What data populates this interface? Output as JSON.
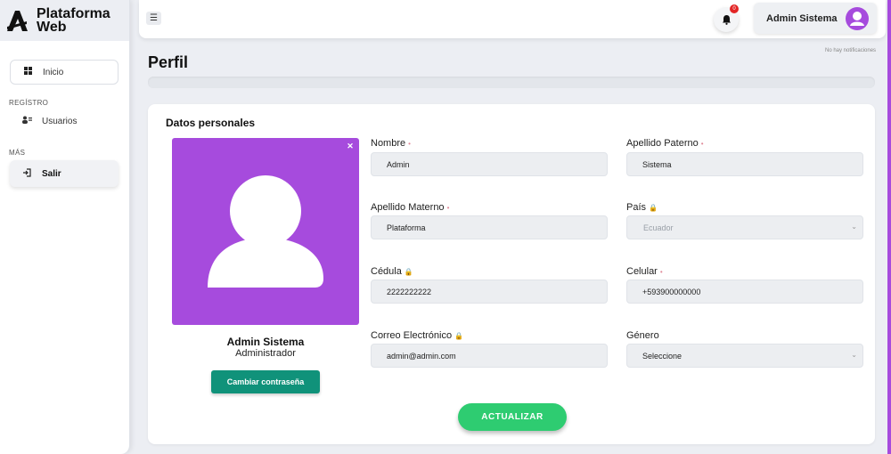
{
  "brand": {
    "name_line1": "Plataforma",
    "name_line2": "Web"
  },
  "sidebar": {
    "home_label": "Inicio",
    "section_registro": "REGÍSTRO",
    "users_label": "Usuarios",
    "section_mas": "MÁS",
    "logout_label": "Salir"
  },
  "topbar": {
    "notification_count": "0",
    "user_name": "Admin Sistema",
    "notification_text": "No hay notificaciones"
  },
  "page": {
    "title": "Perfil"
  },
  "profile": {
    "section_title": "Datos personales",
    "full_name": "Admin Sistema",
    "role": "Administrador",
    "change_password_label": "Cambiar contraseña",
    "update_label": "ACTUALIZAR"
  },
  "fields": {
    "nombre": {
      "label": "Nombre",
      "value": "Admin"
    },
    "apellido_paterno": {
      "label": "Apellido Paterno",
      "value": "Sistema"
    },
    "apellido_materno": {
      "label": "Apellido Materno",
      "value": "Plataforma"
    },
    "pais": {
      "label": "País",
      "value": "Ecuador"
    },
    "cedula": {
      "label": "Cédula",
      "value": "2222222222"
    },
    "celular": {
      "label": "Celular",
      "value": "+593900000000"
    },
    "correo": {
      "label": "Correo Electrónico",
      "value": "admin@admin.com"
    },
    "genero": {
      "label": "Género",
      "value": "Seleccione"
    }
  },
  "colors": {
    "accent": "#a64bdd",
    "teal": "#10927a",
    "green": "#2ecc71",
    "badge": "#e32626"
  }
}
